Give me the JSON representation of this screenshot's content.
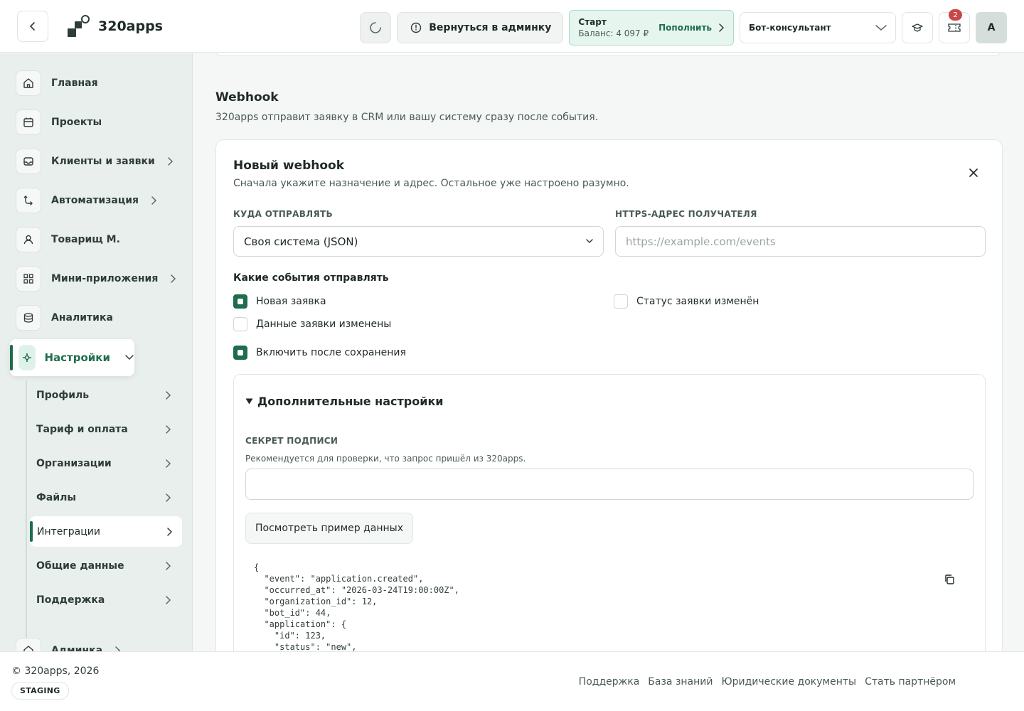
{
  "header": {
    "app_name": "320apps",
    "admin_button": "Вернуться в админку",
    "plan": {
      "name": "Старт",
      "balance": "Баланс: 4 097 ₽",
      "topup": "Пополнить"
    },
    "bot_select": "Бот-консультант",
    "notifications_count": "2",
    "avatar_letter": "А"
  },
  "sidebar": {
    "items": [
      {
        "label": "Главная",
        "icon": "home-icon"
      },
      {
        "label": "Проекты",
        "icon": "calendar-icon"
      },
      {
        "label": "Клиенты и заявки",
        "icon": "inbox-icon"
      },
      {
        "label": "Автоматизация",
        "icon": "automation-icon"
      },
      {
        "label": "Товарищ М.",
        "icon": "user-icon"
      },
      {
        "label": "Мини-приложения",
        "icon": "apps-icon"
      },
      {
        "label": "Аналитика",
        "icon": "database-icon"
      },
      {
        "label": "Настройки",
        "icon": "settings-icon"
      },
      {
        "label": "Админка",
        "icon": "admin-icon"
      }
    ],
    "sub_items": [
      {
        "label": "Профиль"
      },
      {
        "label": "Тариф и оплата"
      },
      {
        "label": "Организации"
      },
      {
        "label": "Файлы"
      },
      {
        "label": "Интеграции"
      },
      {
        "label": "Общие данные"
      },
      {
        "label": "Поддержка"
      }
    ]
  },
  "main": {
    "section_title": "Webhook",
    "section_subtitle": "320apps отправит заявку в CRM или вашу систему сразу после события.",
    "card": {
      "title": "Новый webhook",
      "subtitle": "Сначала укажите назначение и адрес. Остальное уже настроено разумно.",
      "dest_label": "КУДА ОТПРАВЛЯТЬ",
      "dest_value": "Своя система (JSON)",
      "url_label": "HTTPS-АДРЕС ПОЛУЧАТЕЛЯ",
      "url_placeholder": "https://example.com/events",
      "events_title": "Какие события отправлять",
      "events": [
        {
          "label": "Новая заявка",
          "checked": true
        },
        {
          "label": "Статус заявки изменён",
          "checked": false
        },
        {
          "label": "Данные заявки изменены",
          "checked": false
        }
      ],
      "enable_label": "Включить после сохранения",
      "advanced": {
        "title": "Дополнительные настройки",
        "secret_label": "СЕКРЕТ ПОДПИСИ",
        "secret_hint": "Рекомендуется для проверки, что запрос пришёл из 320apps.",
        "example_button": "Посмотреть пример данных",
        "code": "{\n  \"event\": \"application.created\",\n  \"occurred_at\": \"2026-03-24T19:00:00Z\",\n  \"organization_id\": 12,\n  \"bot_id\": 44,\n  \"application\": {\n    \"id\": 123,\n    \"status\": \"new\","
      }
    }
  },
  "footer": {
    "copyright": "© 320apps, 2026",
    "env_badge": "STAGING",
    "links": [
      "Поддержка",
      "База знаний",
      "Юридические документы",
      "Стать партнёром"
    ]
  },
  "colors": {
    "accent": "#1e6d4c",
    "badge": "#c94747",
    "plan_bg": "#e6f6ee"
  }
}
